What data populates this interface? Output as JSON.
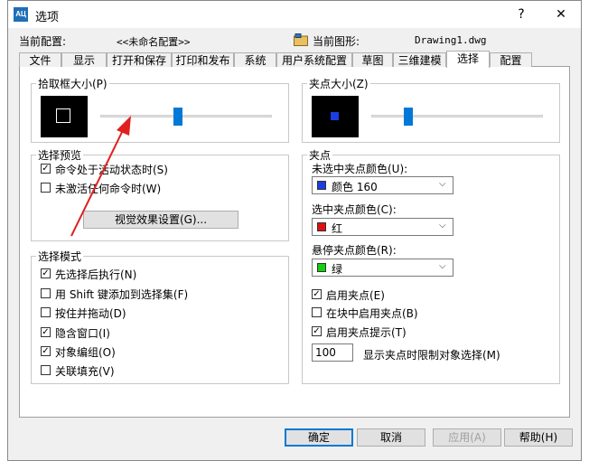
{
  "window": {
    "app_icon_text": "AЦ",
    "title": "选项",
    "help_glyph": "?",
    "close_glyph": "✕"
  },
  "header": {
    "current_profile_label": "当前配置:",
    "current_profile_value": "<<未命名配置>>",
    "current_drawing_label": "当前图形:",
    "current_drawing_value": "Drawing1.dwg"
  },
  "tabs": [
    "文件",
    "显示",
    "打开和保存",
    "打印和发布",
    "系统",
    "用户系统配置",
    "草图",
    "三维建模",
    "选择",
    "配置"
  ],
  "pickbox": {
    "title": "拾取框大小(P)",
    "level": 0.45
  },
  "grip_size": {
    "title": "夹点大小(Z)",
    "level": 0.2
  },
  "selection_preview": {
    "title": "选择预览",
    "items": [
      {
        "label": "命令处于活动状态时(S)",
        "checked": true
      },
      {
        "label": "未激活任何命令时(W)",
        "checked": false
      }
    ],
    "button": "视觉效果设置(G)..."
  },
  "selection_modes": {
    "title": "选择模式",
    "items": [
      {
        "label": "先选择后执行(N)",
        "checked": true
      },
      {
        "label": "用 Shift 键添加到选择集(F)",
        "checked": false
      },
      {
        "label": "按住并拖动(D)",
        "checked": false
      },
      {
        "label": "隐含窗口(I)",
        "checked": true
      },
      {
        "label": "对象编组(O)",
        "checked": true
      },
      {
        "label": "关联填充(V)",
        "checked": false
      }
    ]
  },
  "grips": {
    "title": "夹点",
    "unselected_label": "未选中夹点颜色(U):",
    "unselected_value": "颜色 160",
    "unselected_color": "#1a3fe0",
    "selected_label": "选中夹点颜色(C):",
    "selected_value": "红",
    "selected_color": "#e01010",
    "hover_label": "悬停夹点颜色(R):",
    "hover_value": "绿",
    "hover_color": "#10d010",
    "options": [
      {
        "label": "启用夹点(E)",
        "checked": true
      },
      {
        "label": "在块中启用夹点(B)",
        "checked": false
      },
      {
        "label": "启用夹点提示(T)",
        "checked": true
      }
    ],
    "limit_value": "100",
    "limit_label": "显示夹点时限制对象选择(M)"
  },
  "footer": {
    "ok": "确定",
    "cancel": "取消",
    "apply": "应用(A)",
    "help": "帮助(H)"
  },
  "colors": {
    "accent": "#0078d7",
    "annotation_arrow": "#e02020"
  }
}
